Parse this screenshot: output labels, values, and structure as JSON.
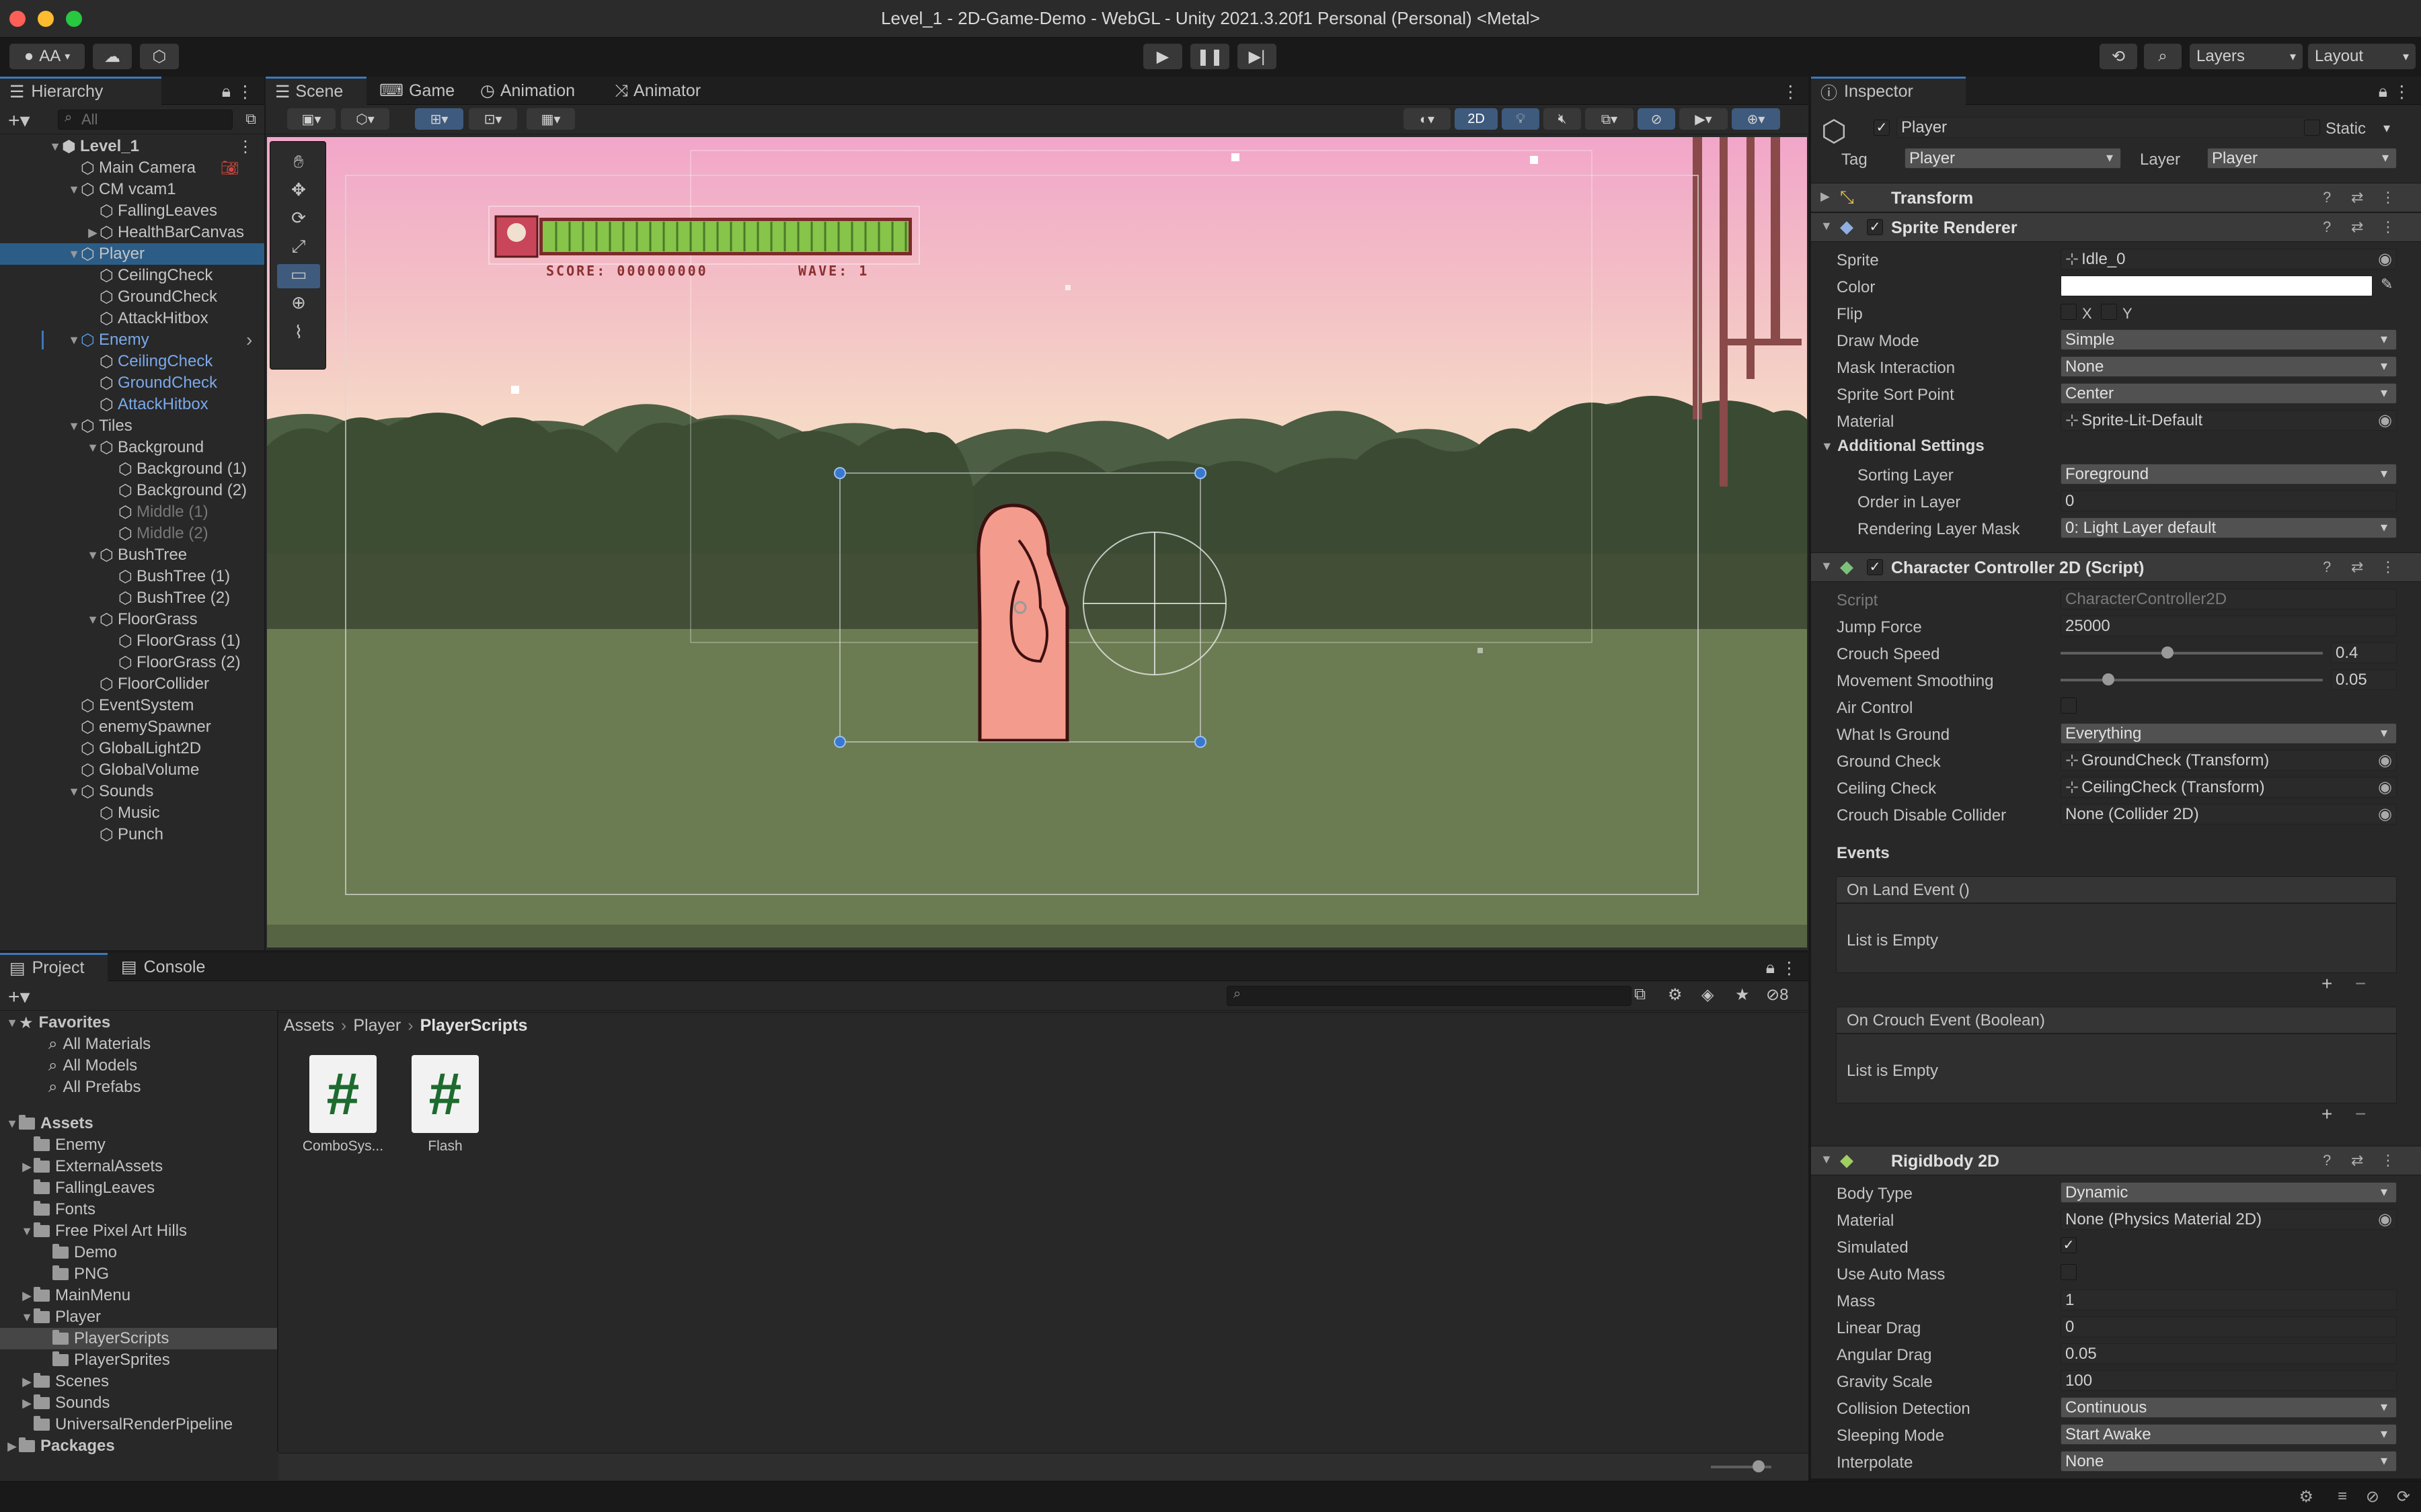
{
  "window": {
    "title": "Level_1 - 2D-Game-Demo - WebGL - Unity 2021.3.20f1 Personal (Personal) <Metal>"
  },
  "toolbar": {
    "account_label": "AA",
    "layers_label": "Layers",
    "layout_label": "Layout"
  },
  "hierarchy": {
    "tab_label": "Hierarchy",
    "search_placeholder": "All",
    "scene_name": "Level_1",
    "items": [
      {
        "label": "Main Camera",
        "depth": 1
      },
      {
        "label": "CM vcam1",
        "depth": 1
      },
      {
        "label": "FallingLeaves",
        "depth": 2
      },
      {
        "label": "HealthBarCanvas",
        "depth": 2
      },
      {
        "label": "Player",
        "depth": 1
      },
      {
        "label": "CeilingCheck",
        "depth": 2
      },
      {
        "label": "GroundCheck",
        "depth": 2
      },
      {
        "label": "AttackHitbox",
        "depth": 2
      },
      {
        "label": "Enemy",
        "depth": 1
      },
      {
        "label": "CeilingCheck",
        "depth": 2
      },
      {
        "label": "GroundCheck",
        "depth": 2
      },
      {
        "label": "AttackHitbox",
        "depth": 2
      },
      {
        "label": "Tiles",
        "depth": 1
      },
      {
        "label": "Background",
        "depth": 2
      },
      {
        "label": "Background (1)",
        "depth": 3
      },
      {
        "label": "Background (2)",
        "depth": 3
      },
      {
        "label": "Middle (1)",
        "depth": 3
      },
      {
        "label": "Middle (2)",
        "depth": 3
      },
      {
        "label": "BushTree",
        "depth": 2
      },
      {
        "label": "BushTree (1)",
        "depth": 3
      },
      {
        "label": "BushTree (2)",
        "depth": 3
      },
      {
        "label": "FloorGrass",
        "depth": 2
      },
      {
        "label": "FloorGrass (1)",
        "depth": 3
      },
      {
        "label": "FloorGrass (2)",
        "depth": 3
      },
      {
        "label": "FloorCollider",
        "depth": 2
      },
      {
        "label": "EventSystem",
        "depth": 1
      },
      {
        "label": "enemySpawner",
        "depth": 1
      },
      {
        "label": "GlobalLight2D",
        "depth": 1
      },
      {
        "label": "GlobalVolume",
        "depth": 1
      },
      {
        "label": "Sounds",
        "depth": 1
      },
      {
        "label": "Music",
        "depth": 2
      },
      {
        "label": "Punch",
        "depth": 2
      }
    ]
  },
  "scene": {
    "tabs": [
      "Scene",
      "Game",
      "Animation",
      "Animator"
    ],
    "mode_2d": "2D",
    "hud": {
      "score": "SCORE: 000000000",
      "wave": "WAVE: 1"
    }
  },
  "inspector": {
    "tab_label": "Inspector",
    "object_name": "Player",
    "static_label": "Static",
    "tag_label": "Tag",
    "tag_value": "Player",
    "layer_label": "Layer",
    "layer_value": "Player",
    "transform_title": "Transform",
    "sprite_renderer": {
      "title": "Sprite Renderer",
      "sprite_label": "Sprite",
      "sprite_value": "Idle_0",
      "color_label": "Color",
      "flip_label": "Flip",
      "flip_x": "X",
      "flip_y": "Y",
      "draw_mode_label": "Draw Mode",
      "draw_mode_value": "Simple",
      "mask_label": "Mask Interaction",
      "mask_value": "None",
      "sort_point_label": "Sprite Sort Point",
      "sort_point_value": "Center",
      "material_label": "Material",
      "material_value": "Sprite-Lit-Default",
      "additional_label": "Additional Settings",
      "sorting_layer_label": "Sorting Layer",
      "sorting_layer_value": "Foreground",
      "order_label": "Order in Layer",
      "order_value": "0",
      "rendering_mask_label": "Rendering Layer Mask",
      "rendering_mask_value": "0: Light Layer default"
    },
    "character_controller": {
      "title": "Character Controller 2D (Script)",
      "script_label": "Script",
      "script_value": "CharacterController2D",
      "jump_label": "Jump Force",
      "jump_value": "25000",
      "crouch_speed_label": "Crouch Speed",
      "crouch_speed_value": "0.4",
      "move_smooth_label": "Movement Smoothing",
      "move_smooth_value": "0.05",
      "air_control_label": "Air Control",
      "ground_label": "What Is Ground",
      "ground_value": "Everything",
      "ground_check_label": "Ground Check",
      "ground_check_value": "GroundCheck (Transform)",
      "ceiling_check_label": "Ceiling Check",
      "ceiling_check_value": "CeilingCheck (Transform)",
      "crouch_disable_label": "Crouch Disable Collider",
      "crouch_disable_value": "None (Collider 2D)",
      "events_label": "Events",
      "land_event": "On Land Event ()",
      "crouch_event": "On Crouch Event (Boolean)",
      "list_empty": "List is Empty"
    },
    "rigidbody": {
      "title": "Rigidbody 2D",
      "body_type_label": "Body Type",
      "body_type_value": "Dynamic",
      "material_label": "Material",
      "material_value": "None (Physics Material 2D)",
      "simulated_label": "Simulated",
      "auto_mass_label": "Use Auto Mass",
      "mass_label": "Mass",
      "mass_value": "1",
      "linear_drag_label": "Linear Drag",
      "linear_drag_value": "0",
      "angular_drag_label": "Angular Drag",
      "angular_drag_value": "0.05",
      "gravity_label": "Gravity Scale",
      "gravity_value": "100",
      "collision_label": "Collision Detection",
      "collision_value": "Continuous",
      "sleeping_label": "Sleeping Mode",
      "sleeping_value": "Start Awake",
      "interpolate_label": "Interpolate",
      "interpolate_value": "None"
    }
  },
  "project": {
    "tabs": [
      "Project",
      "Console"
    ],
    "hidden_count": "8",
    "breadcrumb": [
      "Assets",
      "Player",
      "PlayerScripts"
    ],
    "favorites_label": "Favorites",
    "favorites": [
      "All Materials",
      "All Models",
      "All Prefabs"
    ],
    "assets_label": "Assets",
    "folders": [
      {
        "label": "Enemy",
        "depth": 1
      },
      {
        "label": "ExternalAssets",
        "depth": 1
      },
      {
        "label": "FallingLeaves",
        "depth": 1
      },
      {
        "label": "Fonts",
        "depth": 1
      },
      {
        "label": "Free Pixel Art Hills",
        "depth": 1
      },
      {
        "label": "Demo",
        "depth": 2
      },
      {
        "label": "PNG",
        "depth": 2
      },
      {
        "label": "MainMenu",
        "depth": 1
      },
      {
        "label": "Player",
        "depth": 1
      },
      {
        "label": "PlayerScripts",
        "depth": 2
      },
      {
        "label": "PlayerSprites",
        "depth": 2
      },
      {
        "label": "Scenes",
        "depth": 1
      },
      {
        "label": "Sounds",
        "depth": 1
      },
      {
        "label": "UniversalRenderPipeline",
        "depth": 1
      }
    ],
    "packages_label": "Packages",
    "files": [
      "ComboSys...",
      "Flash"
    ]
  }
}
